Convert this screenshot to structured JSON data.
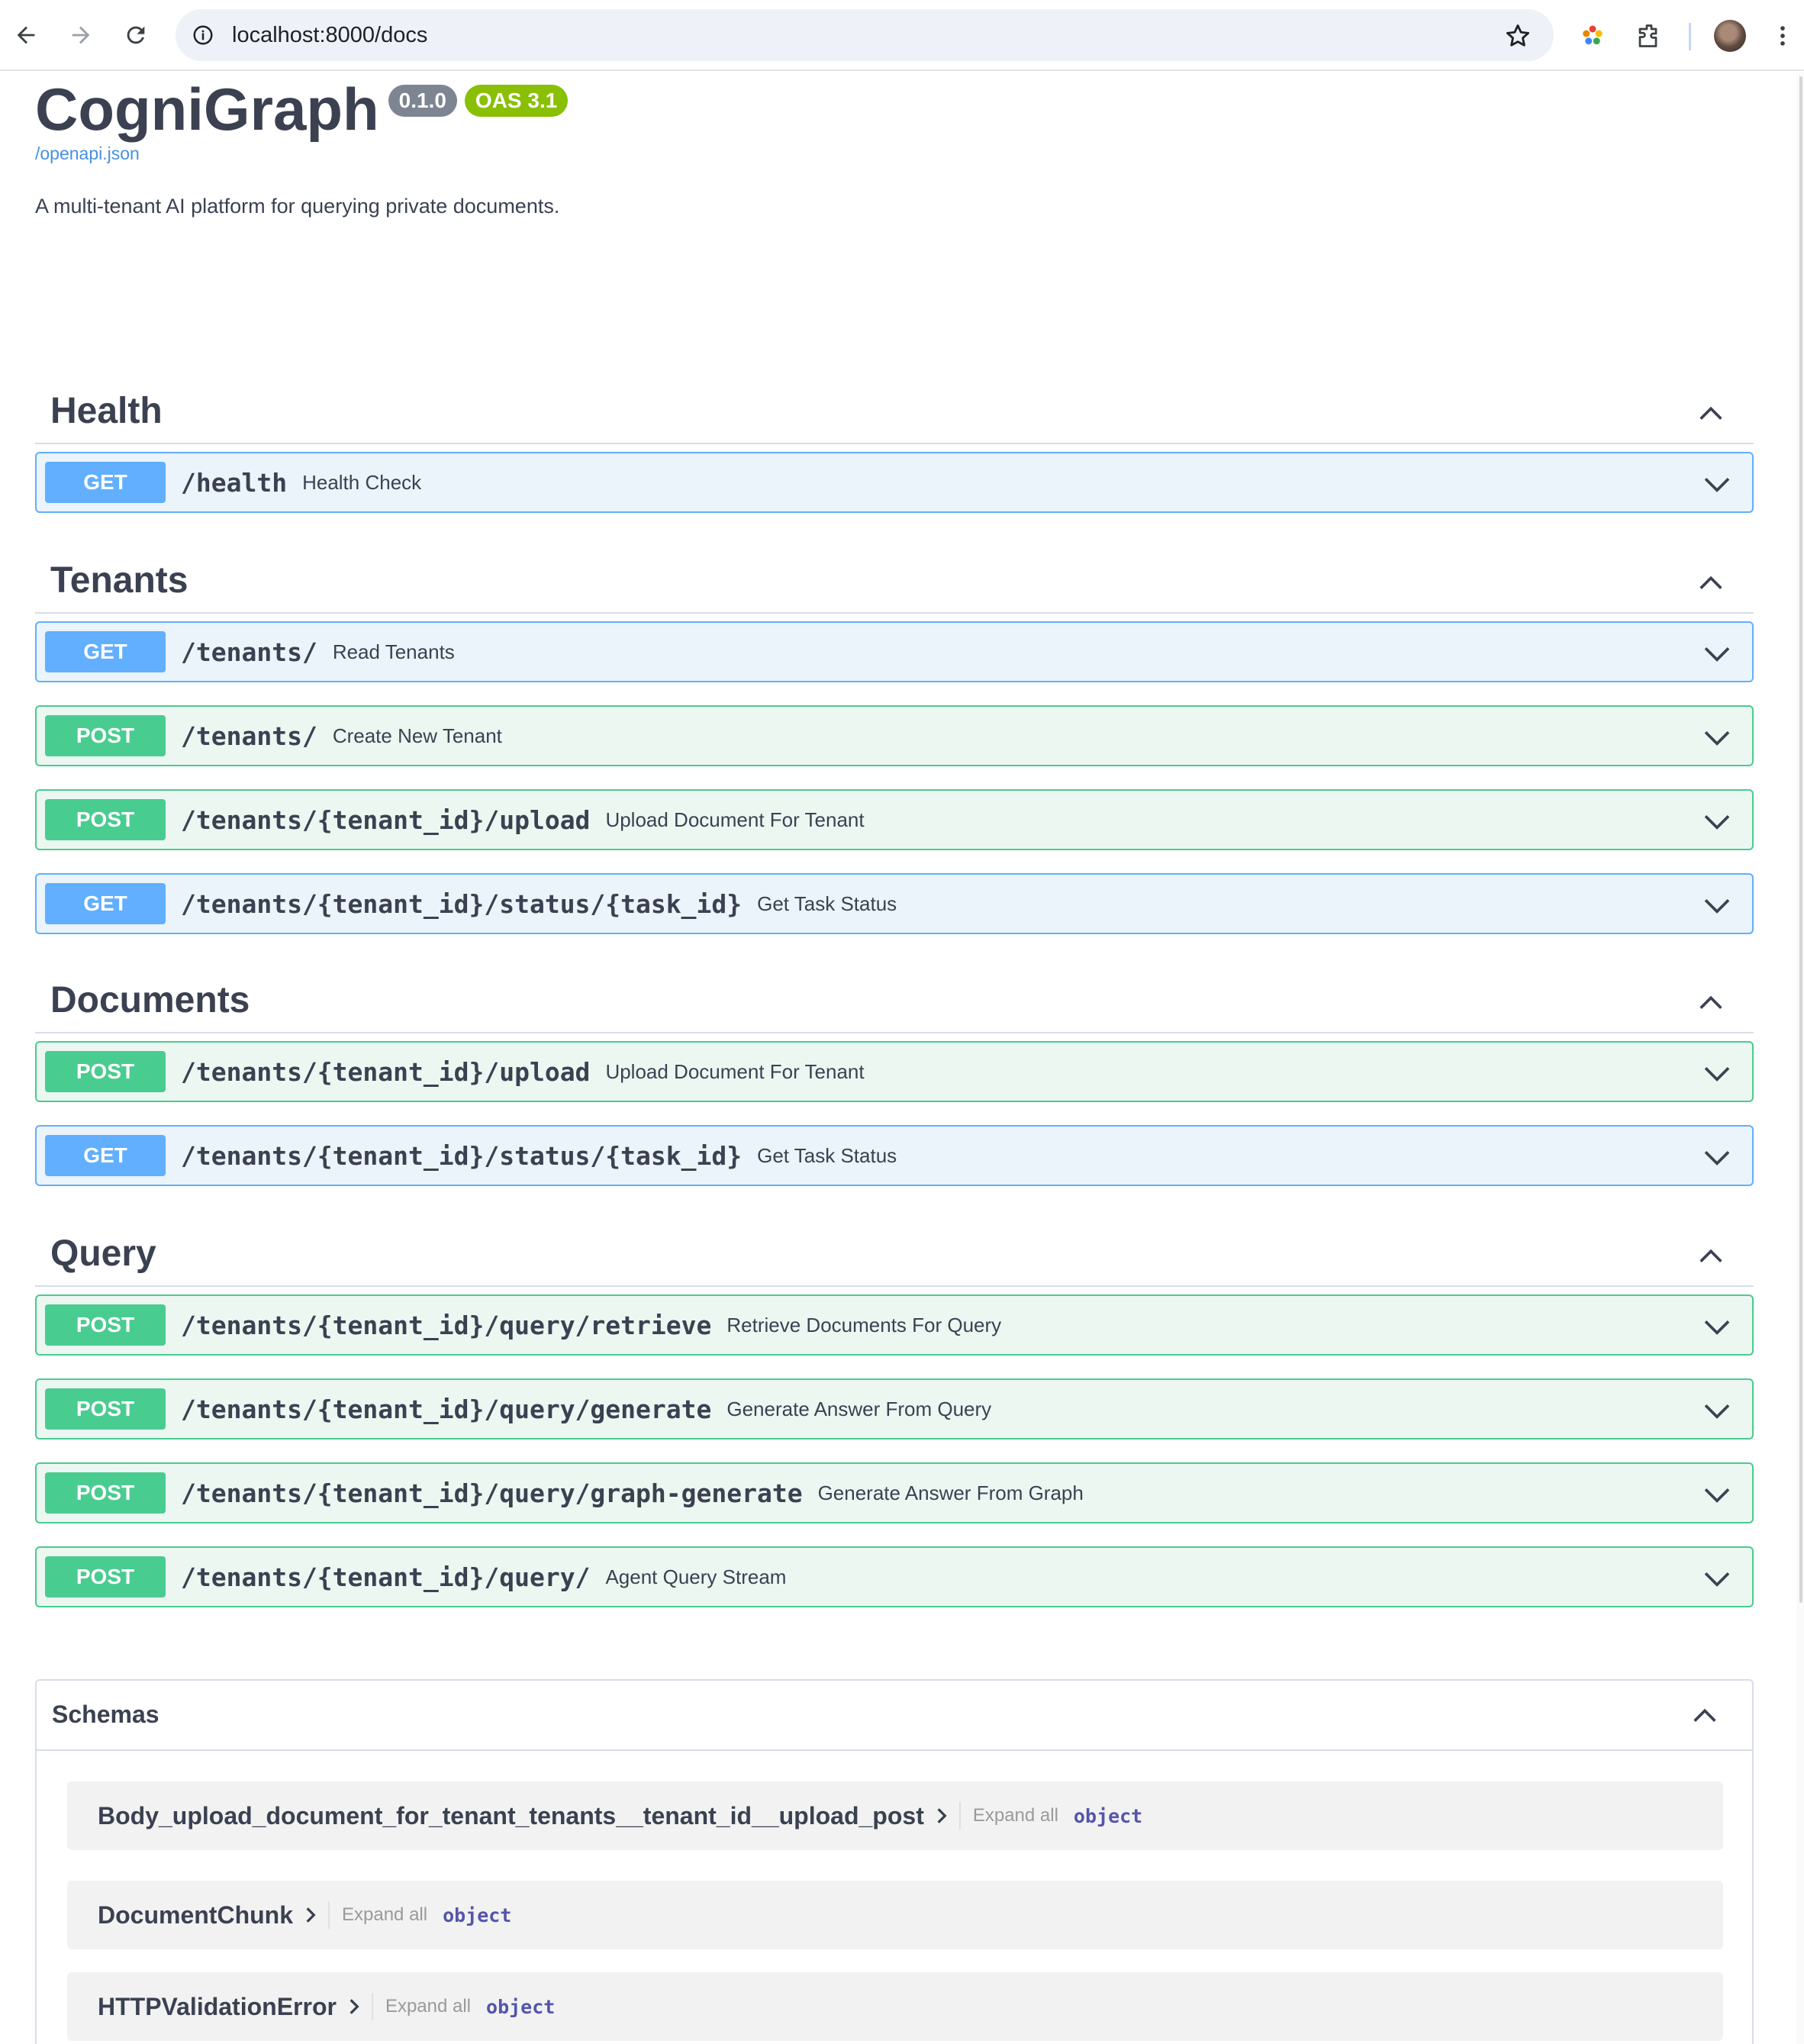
{
  "browser": {
    "url": "localhost:8000/docs"
  },
  "header": {
    "title": "CogniGraph",
    "version_badge": "0.1.0",
    "oas_badge": "OAS 3.1",
    "openapi_link": "/openapi.json",
    "description": "A multi-tenant AI platform for querying private documents."
  },
  "colors": {
    "get": "#61affe",
    "post": "#49cc90",
    "text": "#3b4151",
    "oas_badge": "#89bf04",
    "version_badge": "#7d8492"
  },
  "tags": [
    {
      "name": "Health",
      "operations": [
        {
          "method": "GET",
          "path": "/health",
          "summary": "Health Check"
        }
      ]
    },
    {
      "name": "Tenants",
      "operations": [
        {
          "method": "GET",
          "path": "/tenants/",
          "summary": "Read Tenants"
        },
        {
          "method": "POST",
          "path": "/tenants/",
          "summary": "Create New Tenant"
        },
        {
          "method": "POST",
          "path": "/tenants/{tenant_id}/upload",
          "summary": "Upload Document For Tenant"
        },
        {
          "method": "GET",
          "path": "/tenants/{tenant_id}/status/{task_id}",
          "summary": "Get Task Status"
        }
      ]
    },
    {
      "name": "Documents",
      "operations": [
        {
          "method": "POST",
          "path": "/tenants/{tenant_id}/upload",
          "summary": "Upload Document For Tenant"
        },
        {
          "method": "GET",
          "path": "/tenants/{tenant_id}/status/{task_id}",
          "summary": "Get Task Status"
        }
      ]
    },
    {
      "name": "Query",
      "operations": [
        {
          "method": "POST",
          "path": "/tenants/{tenant_id}/query/retrieve",
          "summary": "Retrieve Documents For Query"
        },
        {
          "method": "POST",
          "path": "/tenants/{tenant_id}/query/generate",
          "summary": "Generate Answer From Query"
        },
        {
          "method": "POST",
          "path": "/tenants/{tenant_id}/query/graph-generate",
          "summary": "Generate Answer From Graph"
        },
        {
          "method": "POST",
          "path": "/tenants/{tenant_id}/query/",
          "summary": "Agent Query Stream"
        }
      ]
    }
  ],
  "schemas": {
    "title": "Schemas",
    "models": [
      {
        "name": "Body_upload_document_for_tenant_tenants__tenant_id__upload_post",
        "expand_label": "Expand all",
        "type": "object"
      },
      {
        "name": "DocumentChunk",
        "expand_label": "Expand all",
        "type": "object"
      },
      {
        "name": "HTTPValidationError",
        "expand_label": "Expand all",
        "type": "object"
      }
    ]
  }
}
